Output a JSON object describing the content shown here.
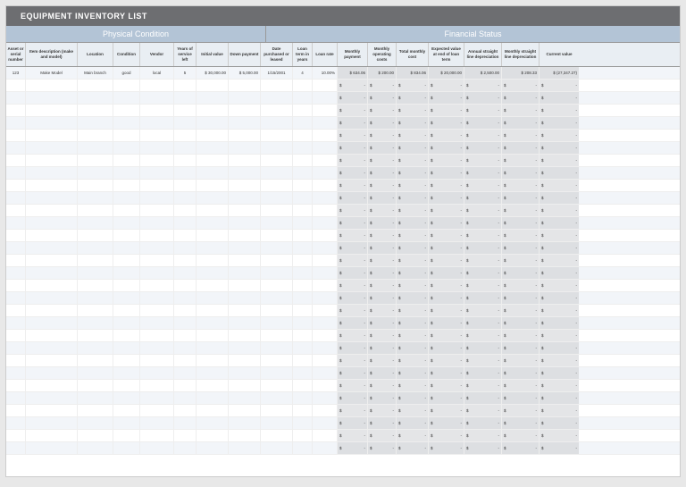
{
  "title": "EQUIPMENT INVENTORY LIST",
  "sections": {
    "left": "Physical Condition",
    "right": "Financial Status"
  },
  "headers": [
    "Asset or serial number",
    "Item description (make and model)",
    "Location",
    "Condition",
    "Vendor",
    "Years of service left",
    "Initial value",
    "Down payment",
    "Date purchased or leased",
    "Loan term in years",
    "Loan rate",
    "Monthly payment",
    "Monthly operating costs",
    "Total monthly cost",
    "Expected value at end of loan term",
    "Annual straight line depreciation",
    "Monthly straight line depreciation",
    "Current value"
  ],
  "row1": {
    "asset": "123",
    "desc": "Make Model",
    "location": "Main branch",
    "condition": "good",
    "vendor": "local",
    "years": "5",
    "initial": "$   30,000.00",
    "down": "$    5,000.00",
    "date": "1/15/2001",
    "term": "4",
    "rate": "10.00%",
    "mpay": "$    634.06",
    "mop": "$    200.00",
    "tmc": "$    834.06",
    "ev": "$  20,000.00",
    "asld": "$     2,500.00",
    "msld": "$        208.33",
    "cv": "$      (27,347.27)"
  },
  "dash": "-",
  "blankRows": 30,
  "shadedCols": [
    11,
    12,
    13,
    14,
    15,
    16,
    17
  ]
}
